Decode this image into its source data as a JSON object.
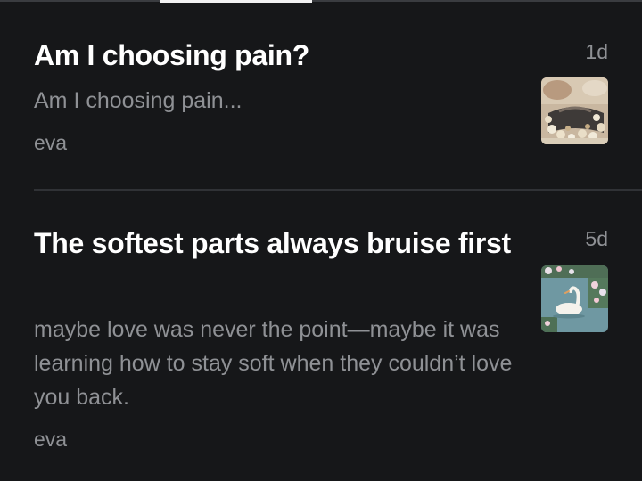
{
  "feed": {
    "posts": [
      {
        "title": "Am I choosing pain?",
        "excerpt": "Am I choosing pain...",
        "author": "eva",
        "age": "1d",
        "thumbnail_icon": "floral-lace-image"
      },
      {
        "title": "The softest parts always bruise first",
        "excerpt": "maybe love was never the point—maybe it was learning how to stay soft when they couldn’t love you back.",
        "author": "eva",
        "age": "5d",
        "thumbnail_icon": "swan-pond-image"
      }
    ]
  },
  "colors": {
    "background": "#161719",
    "title": "#ffffff",
    "muted_text": "#8f9195",
    "divider": "#303236",
    "tab_indicator": "#f2f2f2"
  }
}
